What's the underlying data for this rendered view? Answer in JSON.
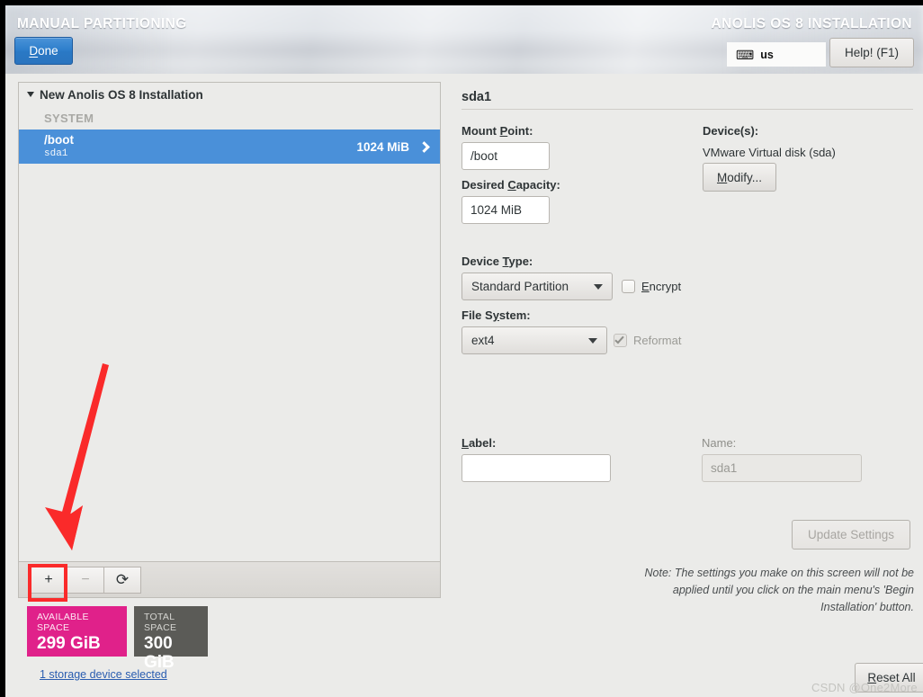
{
  "header": {
    "title_left": "MANUAL PARTITIONING",
    "title_right": "ANOLIS OS 8 INSTALLATION",
    "done_label": "Done",
    "done_accel": "D",
    "keyboard_layout": "us",
    "keyboard_icon": "keyboard-icon",
    "help_label": "Help! (F1)"
  },
  "tree": {
    "root_label": "New Anolis OS 8 Installation",
    "group_label": "SYSTEM",
    "rows": [
      {
        "mount_point": "/boot",
        "device": "sda1",
        "size": "1024 MiB",
        "selected": true
      }
    ]
  },
  "toolbar": {
    "add_label": "+",
    "remove_label": "−",
    "refresh_label": "⟳"
  },
  "space": {
    "available_caption": "AVAILABLE SPACE",
    "available_value": "299 GiB",
    "available_color": "#e0218a",
    "total_caption": "TOTAL SPACE",
    "total_value": "300 GiB",
    "total_color": "#5b5b57"
  },
  "storage_link": "1 storage device selected",
  "detail": {
    "title": "sda1",
    "mount_point_label": "Mount Point:",
    "mount_point_value": "/boot",
    "desired_capacity_label": "Desired Capacity:",
    "desired_capacity_value": "1024 MiB",
    "device_type_label": "Device Type:",
    "device_type_value": "Standard Partition",
    "encrypt_label": "Encrypt",
    "encrypt_checked": false,
    "file_system_label": "File System:",
    "file_system_value": "ext4",
    "reformat_label": "Reformat",
    "reformat_checked": true,
    "devices_label": "Device(s):",
    "devices_value": "VMware Virtual disk (sda)",
    "modify_label": "Modify...",
    "label_label": "Label:",
    "label_value": "",
    "name_label": "Name:",
    "name_value": "sda1",
    "update_settings_label": "Update Settings",
    "note": "Note:  The settings you make on this screen will not be applied until you click on the main menu's 'Begin Installation' button.",
    "reset_all_label": "Reset All"
  },
  "annotations": {
    "arrow_color": "#fa2a2a",
    "highlight_color": "#fa2a2a",
    "highlight_target": "add-mount-point-button"
  },
  "watermark": "CSDN @One2More"
}
